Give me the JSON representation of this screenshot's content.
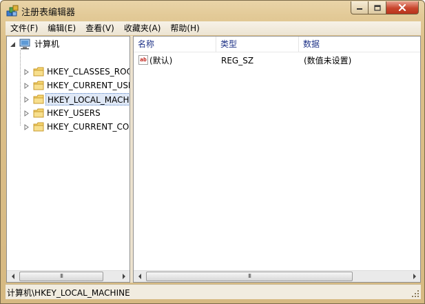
{
  "window": {
    "title": "注册表编辑器"
  },
  "controls": {
    "minimize": "minimize-icon",
    "maximize": "maximize-icon",
    "close": "close-icon"
  },
  "menu": [
    {
      "label": "文件(F)"
    },
    {
      "label": "编辑(E)"
    },
    {
      "label": "查看(V)"
    },
    {
      "label": "收藏夹(A)"
    },
    {
      "label": "帮助(H)"
    }
  ],
  "tree": {
    "root": {
      "label": "计算机",
      "icon": "computer-icon"
    },
    "items": [
      {
        "label": "HKEY_CLASSES_ROOT",
        "selected": false
      },
      {
        "label": "HKEY_CURRENT_USER",
        "selected": false
      },
      {
        "label": "HKEY_LOCAL_MACHINE",
        "selected": true
      },
      {
        "label": "HKEY_USERS",
        "selected": false
      },
      {
        "label": "HKEY_CURRENT_CONFIG",
        "selected": false
      }
    ]
  },
  "list": {
    "columns": {
      "name": "名称",
      "type": "类型",
      "data": "数据"
    },
    "rows": [
      {
        "icon": "string-value-icon",
        "icon_text": "ab",
        "name": "(默认)",
        "type": "REG_SZ",
        "data": "(数值未设置)"
      }
    ]
  },
  "status": {
    "path": "计算机\\HKEY_LOCAL_MACHINE"
  },
  "colors": {
    "frame": "#dcc08a",
    "selection": "#dfe8f6",
    "close": "#c8452c",
    "header_text": "#1e3287"
  }
}
